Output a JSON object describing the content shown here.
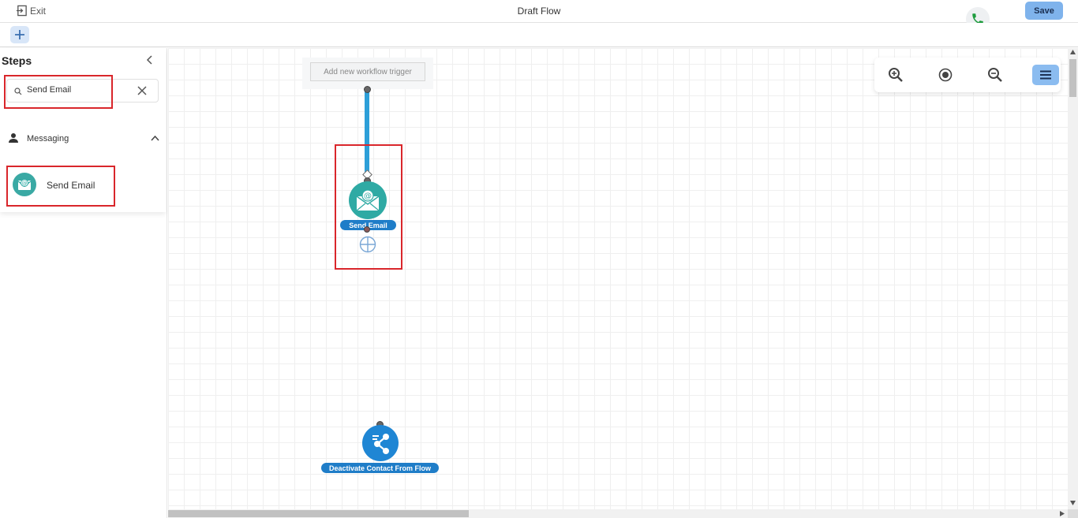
{
  "header": {
    "exit_label": "Exit",
    "title": "Draft Flow",
    "save_label": "Save"
  },
  "sidebar": {
    "title": "Steps",
    "search": {
      "value": "Send Email"
    },
    "category": {
      "label": "Messaging"
    },
    "items": [
      {
        "label": "Send Email",
        "icon": "send-email-icon"
      }
    ]
  },
  "canvas": {
    "trigger_label": "Add new workflow trigger",
    "nodes": [
      {
        "label": "Send Email",
        "icon": "email-icon"
      },
      {
        "label": "Deactivate Contact From Flow",
        "icon": "share-icon"
      }
    ]
  },
  "colors": {
    "accent": "#1f7dc8",
    "email_node": "#2faaa4",
    "connector": "#2d9fd8",
    "highlight": "#d9262b",
    "save_button": "#7fb3ec",
    "phone": "#1e9c3e"
  }
}
